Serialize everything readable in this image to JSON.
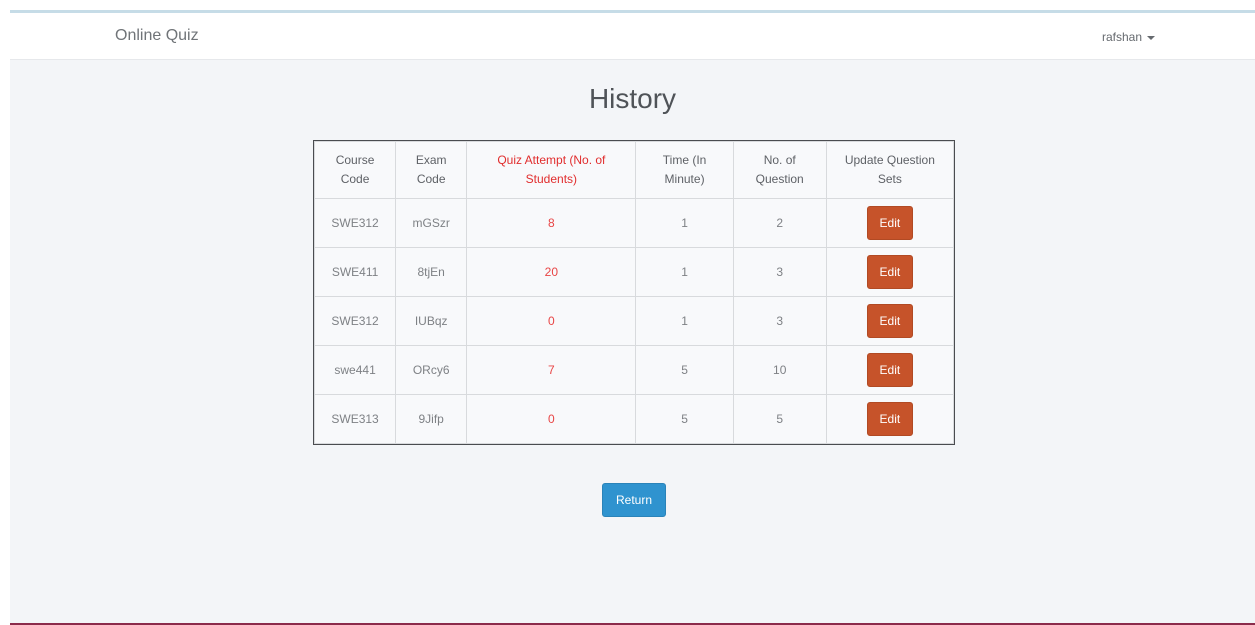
{
  "navbar": {
    "brand": "Online Quiz",
    "user": "rafshan"
  },
  "page": {
    "title": "History"
  },
  "table": {
    "headers": [
      {
        "line1": "Course",
        "line2": "Code"
      },
      {
        "line1": "Exam",
        "line2": "Code"
      },
      {
        "line1": "Quiz Attempt (No. of",
        "line2": "Students)"
      },
      {
        "line1": "Time (In",
        "line2": "Minute)"
      },
      {
        "line1": "No. of",
        "line2": "Question"
      },
      {
        "line1": "Update Question",
        "line2": "Sets"
      }
    ],
    "rows": [
      {
        "course": "SWE312",
        "exam": "mGSzr",
        "attempts": "8",
        "time": "1",
        "questions": "2",
        "action": "Edit"
      },
      {
        "course": "SWE411",
        "exam": "8tjEn",
        "attempts": "20",
        "time": "1",
        "questions": "3",
        "action": "Edit"
      },
      {
        "course": "SWE312",
        "exam": "IUBqz",
        "attempts": "0",
        "time": "1",
        "questions": "3",
        "action": "Edit"
      },
      {
        "course": "swe441",
        "exam": "ORcy6",
        "attempts": "7",
        "time": "5",
        "questions": "10",
        "action": "Edit"
      },
      {
        "course": "SWE313",
        "exam": "9Jifp",
        "attempts": "0",
        "time": "5",
        "questions": "5",
        "action": "Edit"
      }
    ]
  },
  "buttons": {
    "return_label": "Return"
  },
  "colors": {
    "accent_red": "#e12d2d",
    "edit_button": "#c6532a",
    "return_button": "#2f93cf"
  }
}
